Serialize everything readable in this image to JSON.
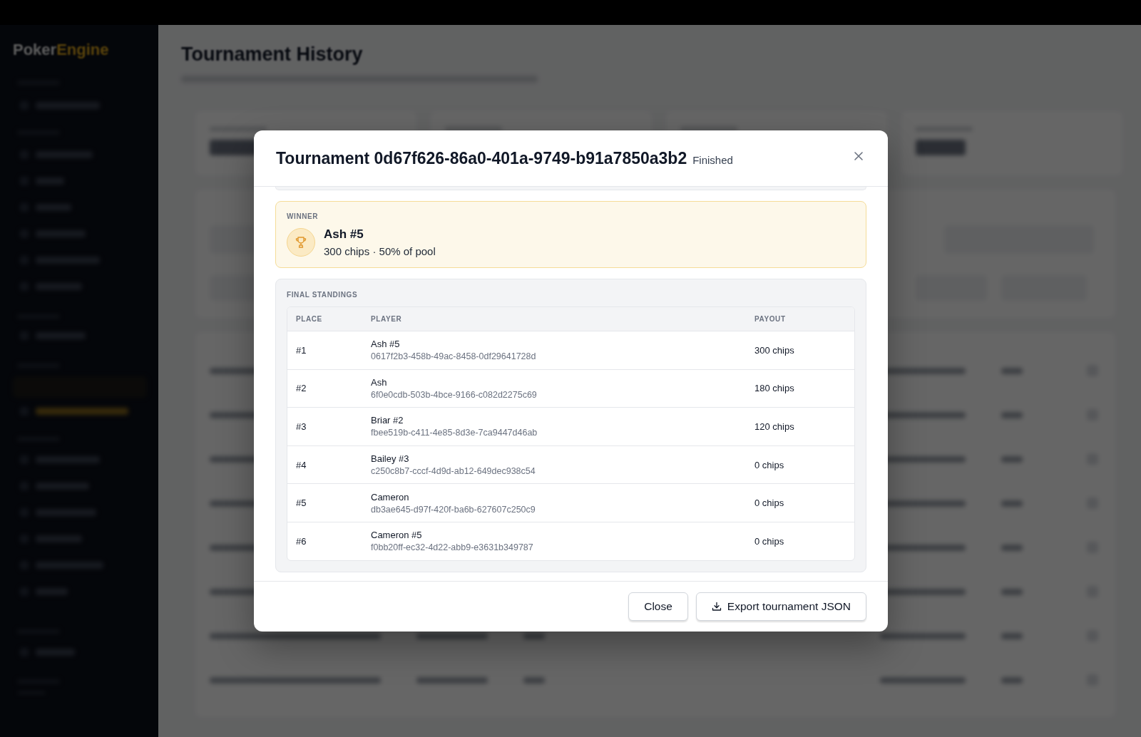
{
  "sidebar": {
    "logo": {
      "primary": "Poker",
      "accent": "Engine"
    }
  },
  "page": {
    "title": "Tournament History"
  },
  "modal": {
    "title": "Tournament 0d67f626-86a0-401a-9749-b91a7850a3b2",
    "status": "Finished",
    "winner": {
      "label": "WINNER",
      "name": "Ash #5",
      "summary": "300 chips · 50% of pool"
    },
    "standings": {
      "title": "FINAL STANDINGS",
      "columns": [
        "PLACE",
        "PLAYER",
        "PAYOUT"
      ],
      "rows": [
        {
          "place": "#1",
          "player": "Ash #5",
          "player_id": "0617f2b3-458b-49ac-8458-0df29641728d",
          "payout": "300 chips"
        },
        {
          "place": "#2",
          "player": "Ash",
          "player_id": "6f0e0cdb-503b-4bce-9166-c082d2275c69",
          "payout": "180 chips"
        },
        {
          "place": "#3",
          "player": "Briar #2",
          "player_id": "fbee519b-c411-4e85-8d3e-7ca9447d46ab",
          "payout": "120 chips"
        },
        {
          "place": "#4",
          "player": "Bailey #3",
          "player_id": "c250c8b7-cccf-4d9d-ab12-649dec938c54",
          "payout": "0 chips"
        },
        {
          "place": "#5",
          "player": "Cameron",
          "player_id": "db3ae645-d97f-420f-ba6b-627607c250c9",
          "payout": "0 chips"
        },
        {
          "place": "#6",
          "player": "Cameron #5",
          "player_id": "f0bb20ff-ec32-4d22-abb9-e3631b349787",
          "payout": "0 chips"
        }
      ]
    },
    "buttons": [
      {
        "label": "Close",
        "kind": "secondary"
      },
      {
        "label": "Export tournament JSON",
        "kind": "export"
      }
    ]
  }
}
